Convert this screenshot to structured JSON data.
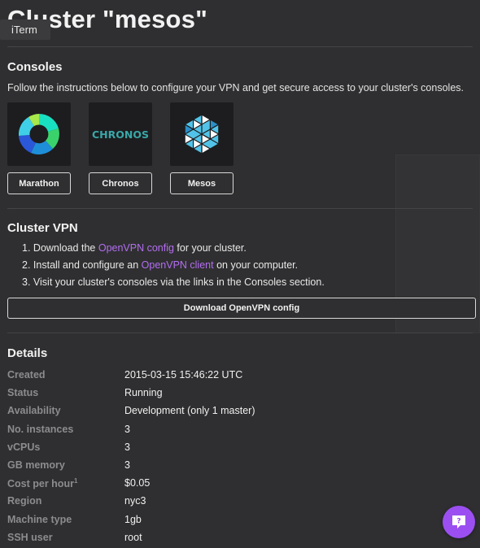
{
  "page": {
    "title": "Cluster \"mesos\""
  },
  "tooltip": {
    "text": "iTerm"
  },
  "consoles": {
    "heading": "Consoles",
    "instructions": "Follow the instructions below to configure your VPN and get secure access to your cluster's consoles.",
    "items": [
      {
        "label": "Marathon",
        "icon": "marathon-logo"
      },
      {
        "label": "Chronos",
        "icon": "chronos-logo",
        "logo_text": "CHRONOS"
      },
      {
        "label": "Mesos",
        "icon": "mesos-logo"
      }
    ]
  },
  "vpn": {
    "heading": "Cluster VPN",
    "steps": [
      {
        "num": "1.",
        "before": "Download the ",
        "link": "OpenVPN config",
        "after": " for your cluster."
      },
      {
        "num": "2.",
        "before": "Install and configure an ",
        "link": "OpenVPN client",
        "after": " on your computer."
      },
      {
        "num": "3.",
        "before": "Visit your cluster's consoles via the links in the Consoles section.",
        "link": "",
        "after": ""
      }
    ],
    "download_label": "Download OpenVPN config"
  },
  "details": {
    "heading": "Details",
    "rows": [
      {
        "label": "Created",
        "value": "2015-03-15 15:46:22 UTC"
      },
      {
        "label": "Status",
        "value": "Running"
      },
      {
        "label": "Availability",
        "value": "Development (only 1 master)"
      },
      {
        "label": "No. instances",
        "value": "3"
      },
      {
        "label": "vCPUs",
        "value": "3"
      },
      {
        "label": "GB memory",
        "value": "3"
      },
      {
        "label": "Cost per hour",
        "sup": "1",
        "value": "$0.05"
      },
      {
        "label": "Region",
        "value": "nyc3"
      },
      {
        "label": "Machine type",
        "value": "1gb"
      },
      {
        "label": "SSH user",
        "value": "root"
      }
    ]
  },
  "colors": {
    "background": "#2f2f31",
    "link": "#b36ef0",
    "help_button": "#9b4ff0"
  }
}
